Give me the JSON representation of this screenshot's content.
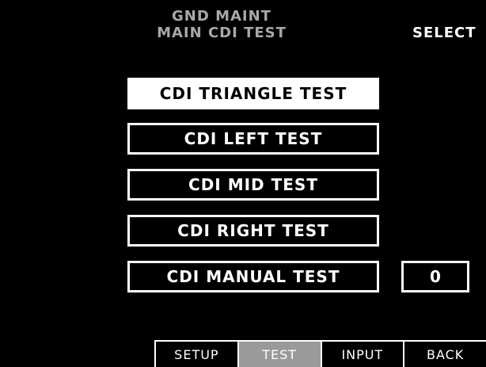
{
  "header": {
    "title_line1": "GND MAINT",
    "title_line2": "MAIN CDI TEST",
    "mode_label": "SELECT"
  },
  "menu": {
    "selected_index": 0,
    "items": [
      {
        "label": "CDI TRIANGLE TEST",
        "selected": true
      },
      {
        "label": "CDI LEFT TEST",
        "selected": false
      },
      {
        "label": "CDI MID TEST",
        "selected": false
      },
      {
        "label": "CDI RIGHT TEST",
        "selected": false
      },
      {
        "label": "CDI MANUAL TEST",
        "selected": false
      }
    ],
    "manual_value": "0"
  },
  "softkeys": {
    "active_index": 1,
    "items": [
      {
        "label": "SETUP"
      },
      {
        "label": "TEST"
      },
      {
        "label": "INPUT"
      },
      {
        "label": "BACK"
      }
    ]
  },
  "colors": {
    "background": "#000000",
    "foreground": "#ffffff",
    "title_gray": "#a8a8a8",
    "active_softkey": "#9a9a9a"
  }
}
